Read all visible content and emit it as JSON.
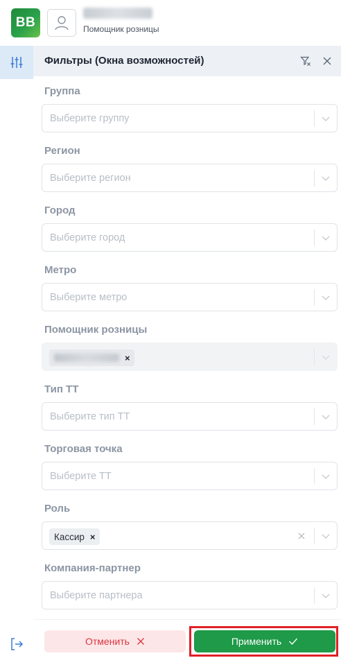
{
  "header": {
    "logo_text": "BB",
    "user_role": "Помощник розницы",
    "brand_color": "#1f8a3c"
  },
  "panel": {
    "title": "Фильтры (Окна возможностей)"
  },
  "fields": [
    {
      "label": "Группа",
      "placeholder": "Выберите группу"
    },
    {
      "label": "Регион",
      "placeholder": "Выберите регион"
    },
    {
      "label": "Город",
      "placeholder": "Выберите город"
    },
    {
      "label": "Метро",
      "placeholder": "Выберите метро"
    },
    {
      "label": "Помощник розницы",
      "disabled": true
    },
    {
      "label": "Тип ТТ",
      "placeholder": "Выберите тип ТТ"
    },
    {
      "label": "Торговая точка",
      "placeholder": "Выберите ТТ"
    },
    {
      "label": "Роль",
      "selected_tag": "Кассир"
    },
    {
      "label": "Компания-партнер",
      "placeholder": "Выберите партнера"
    }
  ],
  "footer": {
    "cancel_label": "Отменить",
    "apply_label": "Применить",
    "cancel_color": "#d9343f",
    "apply_color": "#1e9a48",
    "highlight_color": "#e01f26"
  }
}
